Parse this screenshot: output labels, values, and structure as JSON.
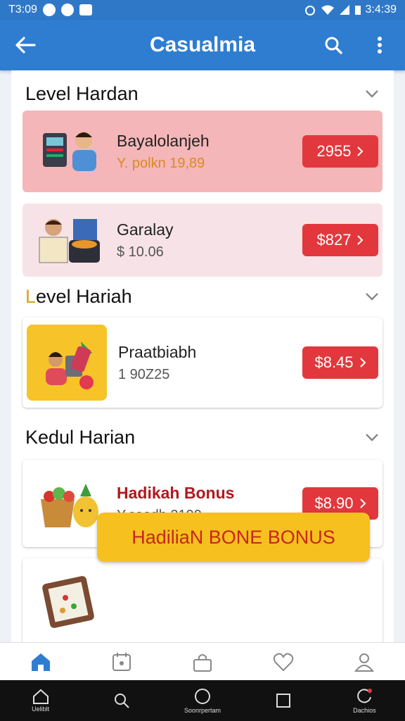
{
  "status_bar": {
    "time_left": "T3:09",
    "time_right": "3:4:39",
    "icons_left": [
      "alarm-icon",
      "message-icon",
      "gallery-icon"
    ],
    "icons_right": [
      "wifi-icon",
      "signal-icon",
      "battery-icon"
    ]
  },
  "app_bar": {
    "title": "Casualmia",
    "icons": [
      "back-arrow-icon",
      "search-icon",
      "more-icon"
    ]
  },
  "sections": [
    {
      "title": "Level Hardan",
      "cards": [
        {
          "title": "Bayalolanjeh",
          "subtitle": "Y. polkn 19,89",
          "price": "2955",
          "style": "pink",
          "thumb_icon": "cashier-icon"
        },
        {
          "title": "Garalay",
          "subtitle": "$ 10.06",
          "price": "$827",
          "style": "lightpink",
          "thumb_icon": "shopping-box-icon"
        }
      ]
    },
    {
      "title_first": "L",
      "title_rest": "evel Hariah",
      "accent": "#d9a21c",
      "cards": [
        {
          "title": "Praatbiabh",
          "subtitle": "1 90Z25",
          "price": "$8.45",
          "style": "white",
          "thumb_icon": "shopping-woman-icon"
        }
      ]
    },
    {
      "title": "Kedul Harian",
      "cards": [
        {
          "title": "Hadikah Bonus",
          "subtitle": "Y.coedh 2199",
          "price": "$8.90",
          "style": "white",
          "thumb_icon": "fruit-basket-icon"
        }
      ]
    }
  ],
  "bonus_banner": {
    "label": "HadiliaN BONE BONUS",
    "thumb_icon": "game-board-icon"
  },
  "bottom_nav": [
    "home-icon",
    "calendar-icon",
    "bag-icon",
    "heart-icon",
    "profile-icon"
  ],
  "system_nav": {
    "labels": [
      "Ueliblt",
      "Soonrpertam",
      "Dachios"
    ],
    "icons": [
      "home-icon",
      "search-icon",
      "circle-home-icon",
      "square-recents-icon",
      "refresh-icon"
    ]
  },
  "colors": {
    "app_bar": "#2f7dd1",
    "price_button": "#e2383d",
    "card_pink": "#f4b6b8",
    "card_lightpink": "#f7e3e7",
    "banner": "#f6c11f",
    "banner_text": "#c8261c"
  }
}
